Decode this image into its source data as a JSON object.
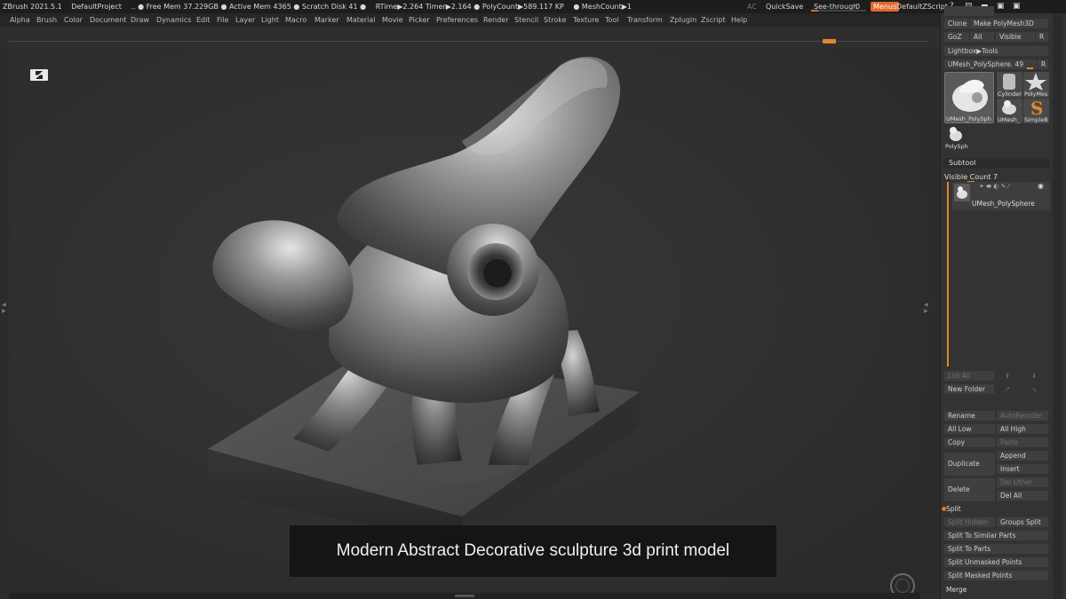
{
  "titlebar": {
    "app": "ZBrush 2021.5.1",
    "project": "DefaultProject",
    "mem": ".. ● Free Mem 37.229GB ● Active Mem 4365 ● Scratch Disk 41 ●",
    "rtime": "RTime▶2.264 Timer▶2.164 ● PolyCount▶589.117 KP",
    "meshcount": "● MeshCount▶1",
    "ac": "AC",
    "quicksave": "QuickSave",
    "seethrough": "See-through",
    "seethrough_value": "0",
    "menus": "Menus",
    "defaultzscript": "DefaultZScript"
  },
  "menubar": [
    "Alpha",
    "Brush",
    "Color",
    "Document",
    "Draw",
    "Dynamics",
    "Edit",
    "File",
    "Layer",
    "Light",
    "Macro",
    "Marker",
    "Material",
    "Movie",
    "Picker",
    "Preferences",
    "Render",
    "Stencil",
    "Stroke",
    "Texture",
    "Tool",
    "Transform",
    "Zplugin",
    "Zscript",
    "Help"
  ],
  "viewport": {
    "caption": "Modern Abstract Decorative sculpture 3d print model"
  },
  "palette": {
    "clone": "Clone",
    "make_polymesh": "Make PolyMesh3D",
    "goz": "GoZ",
    "all": "All",
    "visible": "Visible",
    "r": "R",
    "lightbox_tools": "Lightbox▶Tools",
    "current_tool": "UMesh_PolySphere. 49",
    "thumbs": [
      "UMesh_PolySph",
      "Cylinder",
      "PolyMes",
      "UMesh_",
      "SimpleB",
      "PolySph"
    ],
    "subtool_title": "Subtool",
    "visible_count": "Visible Count 7",
    "subtool_name": "UMesh_PolySphere",
    "list_all": "List All",
    "new_folder": "New Folder",
    "rename": "Rename",
    "auto_reorder": "AutoReorder",
    "all_low": "All Low",
    "all_high": "All High",
    "copy": "Copy",
    "paste": "Paste",
    "append": "Append",
    "duplicate": "Duplicate",
    "insert": "Insert",
    "del_other": "Del Other",
    "delete": "Delete",
    "del_all": "Del All",
    "split": "Split",
    "split_hidden": "Split Hidden",
    "groups_split": "Groups Split",
    "split_similar": "Split To Similar Parts",
    "split_parts": "Split To Parts",
    "split_unmasked": "Split Unmasked Points",
    "split_masked": "Split Masked Points",
    "merge": "Merge"
  },
  "colors": {
    "accent": "#e0872b",
    "menus_button": "#e0682b"
  }
}
